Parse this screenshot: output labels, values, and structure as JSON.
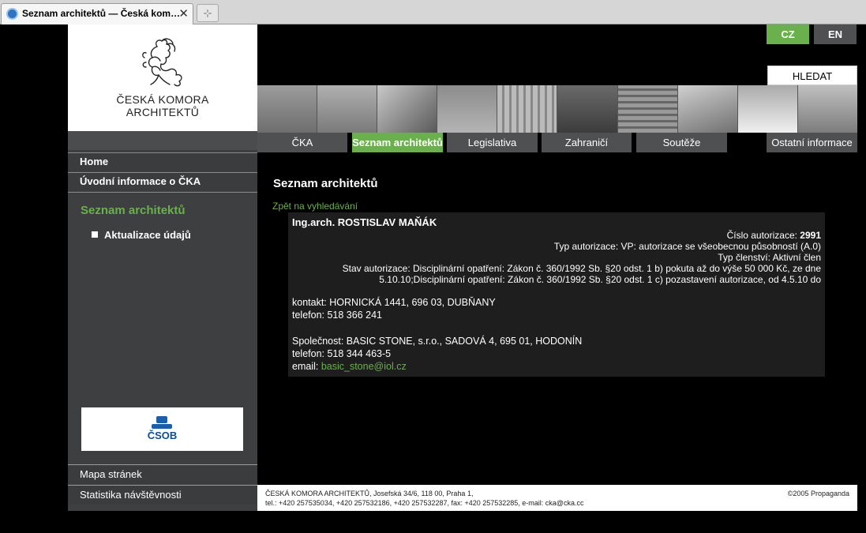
{
  "browser": {
    "tab_title": "Seznam architektů — Česká kom…",
    "close_glyph": "✕",
    "newtab_glyph": "⊹"
  },
  "logo": {
    "line1": "ČESKÁ KOMORA",
    "line2": "ARCHITEKTŮ"
  },
  "sidebar": {
    "items": [
      "Home",
      "Úvodní informace o ČKA"
    ],
    "section_title": "Seznam architektů",
    "sub_item": "Aktualizace údajů",
    "sponsor": "ČSOB",
    "bottom_items": [
      "Mapa stránek",
      "Statistika návštěvnosti"
    ]
  },
  "header": {
    "lang_cz": "CZ",
    "lang_en": "EN",
    "search": "HLEDAT",
    "colors": {
      "accent": "#6ab04c",
      "lang_inactive": "#4e5052"
    }
  },
  "menu": {
    "tabs": [
      "ČKA",
      "Seznam architektů",
      "Legislativa",
      "Zahraničí",
      "Soutěže",
      "Ostatní informace"
    ],
    "active_index": 1
  },
  "main": {
    "title": "Seznam architektů",
    "back_link": "Zpět na vyhledávání",
    "architect": {
      "name": "Ing.arch. ROSTISLAV MAŇÁK",
      "auth_number_label": "Číslo autorizace:",
      "auth_number": "2991",
      "auth_type": "Typ autorizace: VP: autorizace se všeobecnou působností (A.0)",
      "membership": "Typ členství: Aktivní člen",
      "status_line1": "Stav autorizace: Disciplinární opatření: Zákon č. 360/1992 Sb. §20 odst. 1 b) pokuta až do výše 50 000 Kč, ze dne",
      "status_line2": "5.10.10;Disciplinární opatření: Zákon č. 360/1992 Sb. §20 odst. 1 c) pozastavení autorizace, od 4.5.10 do",
      "contact": "kontakt: HORNICKÁ 1441, 696 03, DUBŇANY",
      "phone": "telefon: 518 366 241",
      "company": "Společnost: BASIC STONE, s.r.o., SADOVÁ 4, 695 01, HODONÍN",
      "company_phone": "telefon: 518 344 463-5",
      "email_label": "email:",
      "email": "basic_stone@iol.cz"
    }
  },
  "footer": {
    "line1": "ČESKÁ KOMORA ARCHITEKTŮ, Josefská 34/6, 118 00, Praha 1,",
    "line2": "tel.: +420 257535034, +420 257532186, +420 257532287, fax: +420 257532285, e-mail: cka@cka.cc",
    "copyright": "©2005 Propaganda"
  }
}
